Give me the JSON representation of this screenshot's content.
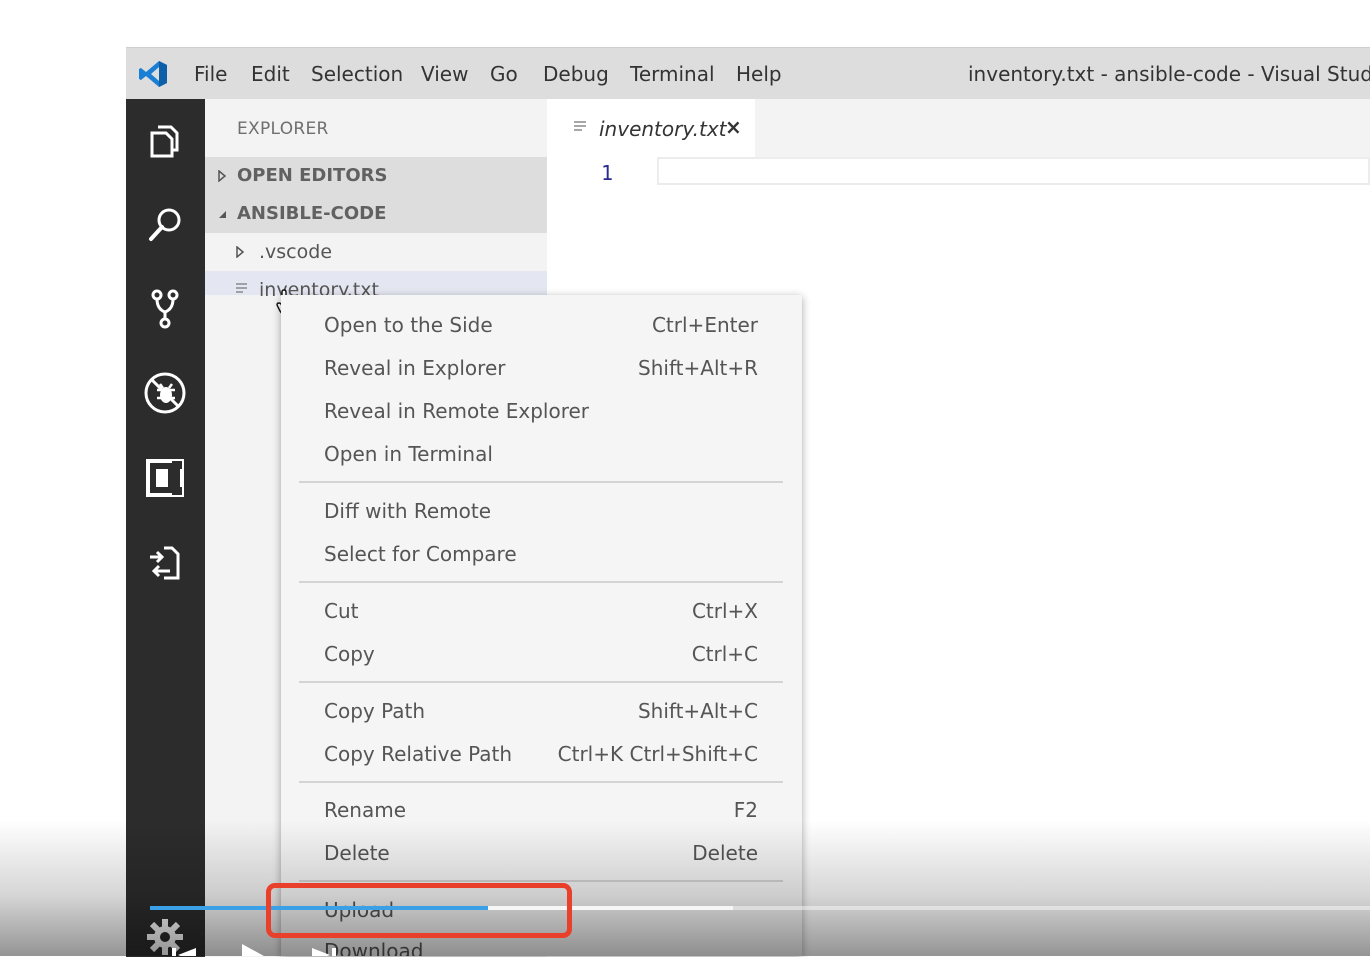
{
  "menubar": {
    "items": [
      "File",
      "Edit",
      "Selection",
      "View",
      "Go",
      "Debug",
      "Terminal",
      "Help"
    ],
    "window_title": "inventory.txt - ansible-code - Visual Studio Cod"
  },
  "activity_bar": {
    "icons": [
      "explorer-icon",
      "search-icon",
      "source-control-icon",
      "debug-icon",
      "remote-explorer-icon",
      "sftp-icon",
      "gear-icon"
    ]
  },
  "sidebar": {
    "title": "EXPLORER",
    "sections": [
      {
        "label": "OPEN EDITORS",
        "expanded": false
      },
      {
        "label": "ANSIBLE-CODE",
        "expanded": true
      }
    ],
    "tree": [
      {
        "label": ".vscode",
        "type": "folder"
      },
      {
        "label": "inventory.txt",
        "type": "file",
        "selected": true
      }
    ]
  },
  "editor": {
    "tab_label": "inventory.txt",
    "tab_close": "×",
    "line_number": "1"
  },
  "context_menu": {
    "groups": [
      [
        {
          "label": "Open to the Side",
          "shortcut": "Ctrl+Enter"
        },
        {
          "label": "Reveal in Explorer",
          "shortcut": "Shift+Alt+R"
        },
        {
          "label": "Reveal in Remote Explorer",
          "shortcut": ""
        },
        {
          "label": "Open in Terminal",
          "shortcut": ""
        }
      ],
      [
        {
          "label": "Diff with Remote",
          "shortcut": ""
        },
        {
          "label": "Select for Compare",
          "shortcut": ""
        }
      ],
      [
        {
          "label": "Cut",
          "shortcut": "Ctrl+X"
        },
        {
          "label": "Copy",
          "shortcut": "Ctrl+C"
        }
      ],
      [
        {
          "label": "Copy Path",
          "shortcut": "Shift+Alt+C"
        },
        {
          "label": "Copy Relative Path",
          "shortcut": "Ctrl+K Ctrl+Shift+C"
        }
      ],
      [
        {
          "label": "Rename",
          "shortcut": "F2"
        },
        {
          "label": "Delete",
          "shortcut": "Delete"
        }
      ],
      [
        {
          "label": "Upload",
          "shortcut": ""
        },
        {
          "label": "Download",
          "shortcut": ""
        }
      ]
    ]
  },
  "player": {
    "progress_fraction": 0.277,
    "buffered_fraction": 0.478,
    "accent_color": "#3aa0e8",
    "highlight_color": "#e8402a"
  }
}
